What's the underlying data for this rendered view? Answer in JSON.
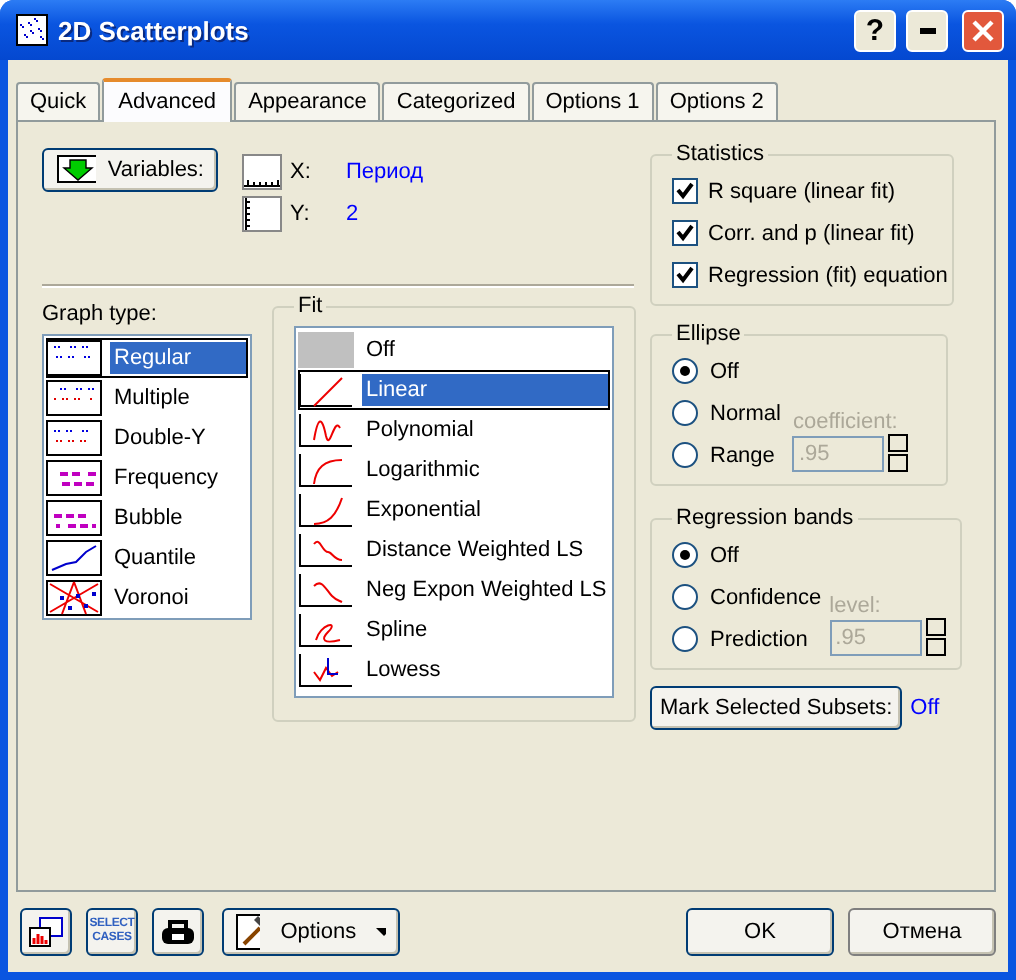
{
  "window": {
    "title": "2D Scatterplots",
    "help": "?"
  },
  "tabs": [
    {
      "label": "Quick",
      "selected": false
    },
    {
      "label": "Advanced",
      "selected": true
    },
    {
      "label": "Appearance",
      "selected": false
    },
    {
      "label": "Categorized",
      "selected": false
    },
    {
      "label": "Options 1",
      "selected": false
    },
    {
      "label": "Options 2",
      "selected": false
    }
  ],
  "variables_button": "Variables:",
  "variables": [
    {
      "axis": "X:",
      "value": "Период"
    },
    {
      "axis": "Y:",
      "value": "2"
    }
  ],
  "statistics": {
    "title": "Statistics",
    "items": [
      {
        "label": "R square (linear fit)",
        "checked": true
      },
      {
        "label": "Corr. and p (linear fit)",
        "checked": true
      },
      {
        "label": "Regression (fit) equation",
        "checked": true
      }
    ]
  },
  "graph_type": {
    "label": "Graph type:",
    "items": [
      {
        "label": "Regular",
        "selected": true
      },
      {
        "label": "Multiple",
        "selected": false
      },
      {
        "label": "Double-Y",
        "selected": false
      },
      {
        "label": "Frequency",
        "selected": false
      },
      {
        "label": "Bubble",
        "selected": false
      },
      {
        "label": "Quantile",
        "selected": false
      },
      {
        "label": "Voronoi",
        "selected": false
      }
    ]
  },
  "fit": {
    "title": "Fit",
    "items": [
      {
        "label": "Off",
        "selected": false
      },
      {
        "label": "Linear",
        "selected": true
      },
      {
        "label": "Polynomial",
        "selected": false
      },
      {
        "label": "Logarithmic",
        "selected": false
      },
      {
        "label": "Exponential",
        "selected": false
      },
      {
        "label": "Distance Weighted LS",
        "selected": false
      },
      {
        "label": "Neg Expon Weighted LS",
        "selected": false
      },
      {
        "label": "Spline",
        "selected": false
      },
      {
        "label": "Lowess",
        "selected": false
      }
    ]
  },
  "ellipse": {
    "title": "Ellipse",
    "options": [
      {
        "label": "Off",
        "selected": true
      },
      {
        "label": "Normal",
        "selected": false
      },
      {
        "label": "Range",
        "selected": false
      }
    ],
    "field_label": "coefficient:",
    "field_value": ".95",
    "disabled": true
  },
  "regression_bands": {
    "title": "Regression bands",
    "options": [
      {
        "label": "Off",
        "selected": true
      },
      {
        "label": "Confidence",
        "selected": false
      },
      {
        "label": "Prediction",
        "selected": false
      }
    ],
    "field_label": "level:",
    "field_value": ".95",
    "disabled": true
  },
  "mark_button": "Mark Selected Subsets:",
  "mark_value": "Off",
  "select_cases": [
    "SELECT",
    "CASES"
  ],
  "options_button": "Options",
  "ok_button": "OK",
  "cancel_button": "Отмена"
}
